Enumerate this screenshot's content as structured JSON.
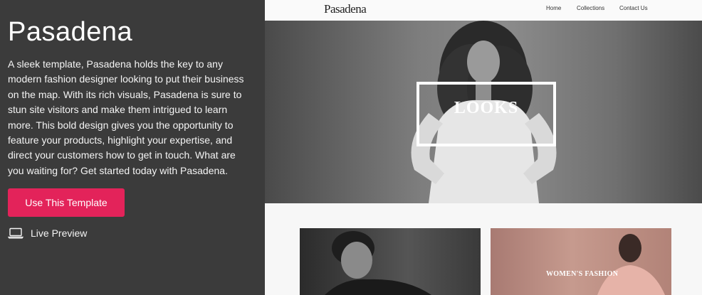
{
  "template": {
    "title": "Pasadena",
    "description": "A sleek template, Pasadena holds the key to any modern fashion designer looking to put their business on the map. With its rich visuals, Pasadena is sure to stun site visitors and make them intrigued to learn more. This bold design gives you the opportunity to feature your products, highlight your expertise, and direct your customers how to get in touch. What are you waiting for? Get started today with Pasadena.",
    "use_button": "Use This Template",
    "live_preview": "Live Preview",
    "live_preview_icon": "laptop-icon",
    "accent_color": "#e3235a"
  },
  "preview": {
    "logo": "Pasadena",
    "nav": [
      "Home",
      "Collections",
      "Contact Us"
    ],
    "hero_text": "LOOKS",
    "card2_text": "WOMEN'S FASHION"
  }
}
